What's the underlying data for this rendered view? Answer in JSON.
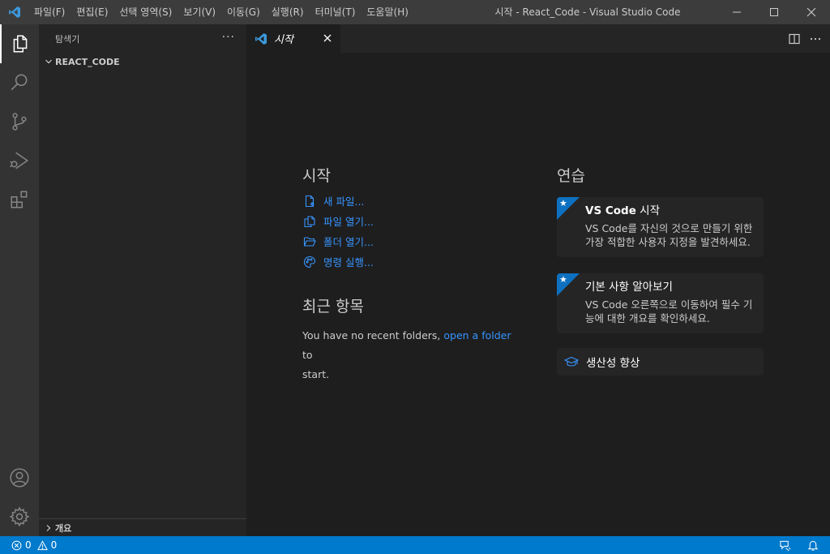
{
  "titlebar": {
    "menu": [
      "파일(F)",
      "편집(E)",
      "선택 영역(S)",
      "보기(V)",
      "이동(G)",
      "실행(R)",
      "터미널(T)",
      "도움말(H)"
    ],
    "window_title": "시작 - React_Code - Visual Studio Code",
    "icons": {
      "logo": "vscode-logo-icon",
      "minimize": "minimize-icon",
      "maximize": "maximize-icon",
      "close": "close-icon"
    }
  },
  "activity_bar": {
    "items": [
      "explorer-icon",
      "search-icon",
      "source-control-icon",
      "run-debug-icon",
      "extensions-icon"
    ],
    "bottom_items": [
      "account-icon",
      "settings-gear-icon"
    ]
  },
  "sidebar": {
    "title": "탐색기",
    "more": "···",
    "folder": "REACT_CODE",
    "outline": "개요"
  },
  "tabs": {
    "active": "시작",
    "close": "close-icon"
  },
  "welcome": {
    "start": {
      "title": "시작",
      "links": [
        {
          "label": "새 파일...",
          "icon": "new-file-icon"
        },
        {
          "label": "파일 열기...",
          "icon": "open-file-icon"
        },
        {
          "label": "폴더 열기...",
          "icon": "open-folder-icon"
        },
        {
          "label": "명령 실행...",
          "icon": "color-palette-icon"
        }
      ]
    },
    "recent": {
      "title": "최근 항목",
      "text_before": "You have no recent folders,",
      "link": "open a folder",
      "text_after": "to",
      "text_end": "start."
    },
    "walkthroughs": {
      "title": "연습",
      "cards": [
        {
          "title_bold": "VS Code",
          "title_rest": " 시작",
          "desc": "VS Code를 자신의 것으로 만들기 위한 가장 적합한 사용자 지정을 발견하세요."
        },
        {
          "title_bold": "",
          "title_rest": "기본 사항 알아보기",
          "desc": "VS Code 오른쪽으로 이동하여 필수 기능에 대한 개요를 확인하세요."
        }
      ],
      "productivity": {
        "label": "생산성 향상",
        "icon": "mortarboard-icon"
      }
    }
  },
  "statusbar": {
    "errors": "0",
    "warnings": "0",
    "right_icons": [
      "feedback-icon",
      "notifications-bell-icon"
    ]
  },
  "colors": {
    "accent": "#007acc",
    "link": "#3794ff",
    "badge": "#0e70c0"
  }
}
